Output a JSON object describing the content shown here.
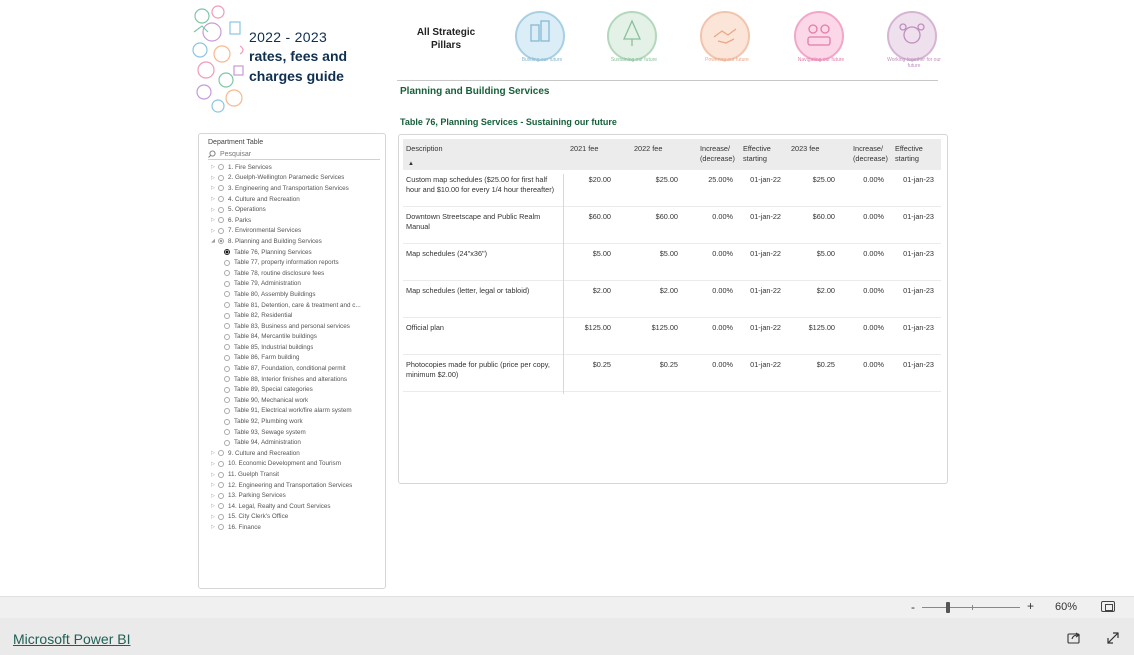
{
  "header": {
    "year": "2022 - 2023",
    "title_line1": "rates, fees and",
    "title_line2": "charges guide",
    "pillars_label": "All Strategic Pillars"
  },
  "pillars": [
    {
      "label": "Building our future",
      "color": "#a9cfe3"
    },
    {
      "label": "Sustaining our future",
      "color": "#b3d8bd"
    },
    {
      "label": "Powering our future",
      "color": "#f3c4ad"
    },
    {
      "label": "Navigating our future",
      "color": "#f2a7c9"
    },
    {
      "label": "Working together for our future",
      "color": "#d6b4d3"
    }
  ],
  "section_title": "Planning and Building Services",
  "table_title": "Table 76, Planning Services - Sustaining our future",
  "slicer": {
    "header": "Department Table",
    "search_placeholder": "Pesquisar",
    "items": [
      {
        "label": "1. Fire Services",
        "level": 0,
        "state": "off"
      },
      {
        "label": "2. Guelph-Wellington Paramedic Services",
        "level": 0,
        "state": "off"
      },
      {
        "label": "3. Engineering and Transportation Services",
        "level": 0,
        "state": "off"
      },
      {
        "label": "4. Culture and Recreation",
        "level": 0,
        "state": "off"
      },
      {
        "label": "5. Operations",
        "level": 0,
        "state": "off"
      },
      {
        "label": "6. Parks",
        "level": 0,
        "state": "off"
      },
      {
        "label": "7. Environmental Services",
        "level": 0,
        "state": "off"
      },
      {
        "label": "8. Planning and Building Services",
        "level": 0,
        "state": "partial",
        "expanded": true
      },
      {
        "label": "Table 76, Planning Services",
        "level": 1,
        "state": "on"
      },
      {
        "label": "Table 77, property information reports",
        "level": 1,
        "state": "off"
      },
      {
        "label": "Table 78, routine disclosure fees",
        "level": 1,
        "state": "off"
      },
      {
        "label": "Table 79, Administration",
        "level": 1,
        "state": "off"
      },
      {
        "label": "Table 80, Assembly Buildings",
        "level": 1,
        "state": "off"
      },
      {
        "label": "Table 81, Detention, care & treatment and c...",
        "level": 1,
        "state": "off"
      },
      {
        "label": "Table 82, Residential",
        "level": 1,
        "state": "off"
      },
      {
        "label": "Table 83, Business and personal services",
        "level": 1,
        "state": "off"
      },
      {
        "label": "Table 84, Mercantile buildings",
        "level": 1,
        "state": "off"
      },
      {
        "label": "Table 85, Industrial buildings",
        "level": 1,
        "state": "off"
      },
      {
        "label": "Table 86, Farm building",
        "level": 1,
        "state": "off"
      },
      {
        "label": "Table 87, Foundation, conditional permit",
        "level": 1,
        "state": "off"
      },
      {
        "label": "Table 88, Interior finishes and alterations",
        "level": 1,
        "state": "off"
      },
      {
        "label": "Table 89, Special categories",
        "level": 1,
        "state": "off"
      },
      {
        "label": "Table 90, Mechanical work",
        "level": 1,
        "state": "off"
      },
      {
        "label": "Table 91, Electrical work/fire alarm system",
        "level": 1,
        "state": "off"
      },
      {
        "label": "Table 92, Plumbing work",
        "level": 1,
        "state": "off"
      },
      {
        "label": "Table 93, Sewage system",
        "level": 1,
        "state": "off"
      },
      {
        "label": "Table 94, Administration",
        "level": 1,
        "state": "off"
      },
      {
        "label": "9. Culture and Recreation",
        "level": 0,
        "state": "off"
      },
      {
        "label": "10. Economic Development and Tourism",
        "level": 0,
        "state": "off"
      },
      {
        "label": "11. Guelph Transit",
        "level": 0,
        "state": "off"
      },
      {
        "label": "12. Engineering and Transportation Services",
        "level": 0,
        "state": "off"
      },
      {
        "label": "13. Parking Services",
        "level": 0,
        "state": "off"
      },
      {
        "label": "14. Legal, Realty and Court Services",
        "level": 0,
        "state": "off"
      },
      {
        "label": "15. City Clerk's Office",
        "level": 0,
        "state": "off"
      },
      {
        "label": "16. Finance",
        "level": 0,
        "state": "off"
      }
    ]
  },
  "table": {
    "columns": [
      "Description",
      "2021 fee",
      "2022 fee",
      "Increase/ (decrease)",
      "Effective starting",
      "2023 fee",
      "Increase/ (decrease)",
      "Effective starting"
    ],
    "sort_indicator": "▲",
    "rows": [
      [
        "Custom map schedules ($25.00 for first half hour and $10.00 for every 1/4 hour thereafter)",
        "$20.00",
        "$25.00",
        "25.00%",
        "01-jan-22",
        "$25.00",
        "0.00%",
        "01-jan-23"
      ],
      [
        "Downtown Streetscape and Public Realm Manual",
        "$60.00",
        "$60.00",
        "0.00%",
        "01-jan-22",
        "$60.00",
        "0.00%",
        "01-jan-23"
      ],
      [
        "Map schedules (24\"x36\")",
        "$5.00",
        "$5.00",
        "0.00%",
        "01-jan-22",
        "$5.00",
        "0.00%",
        "01-jan-23"
      ],
      [
        "Map schedules (letter, legal or tabloid)",
        "$2.00",
        "$2.00",
        "0.00%",
        "01-jan-22",
        "$2.00",
        "0.00%",
        "01-jan-23"
      ],
      [
        "Official plan",
        "$125.00",
        "$125.00",
        "0.00%",
        "01-jan-22",
        "$125.00",
        "0.00%",
        "01-jan-23"
      ],
      [
        "Photocopies made for public (price per copy, minimum $2.00)",
        "$0.25",
        "$0.25",
        "0.00%",
        "01-jan-22",
        "$0.25",
        "0.00%",
        "01-jan-23"
      ]
    ]
  },
  "zoom": {
    "minus": "-",
    "plus": "+",
    "level": "60%",
    "fraction": 0.27
  },
  "footer": {
    "brand_link": "Microsoft Power BI"
  }
}
